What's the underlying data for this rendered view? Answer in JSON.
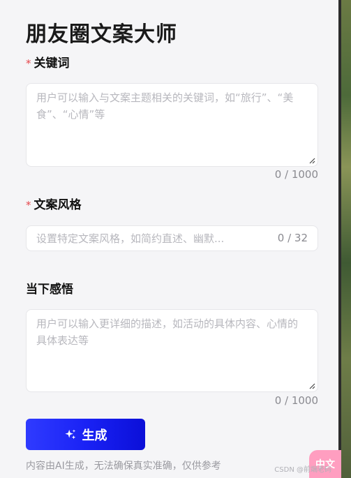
{
  "app": {
    "title": "朋友圈文案大师"
  },
  "keywords": {
    "required_mark": "*",
    "label": "关键词",
    "placeholder": "用户可以输入与文案主题相关的关键词，如“旅行”、“美食”、“心情”等",
    "value": "",
    "counter": "0 / 1000"
  },
  "style": {
    "required_mark": "*",
    "label": "文案风格",
    "placeholder": "设置特定文案风格，如简约直述、幽默...",
    "value": "",
    "counter": "0 / 32"
  },
  "feeling": {
    "label": "当下感悟",
    "placeholder": "用户可以输入更详细的描述，如活动的具体内容、心情的具体表达等",
    "value": "",
    "counter": "0 / 1000"
  },
  "actions": {
    "generate_label": "生成",
    "generate_icon": "sparkle-icon"
  },
  "footer": {
    "disclaimer": "内容由AI生成，无法确保真实准确，仅供参考",
    "watermark": "CSDN @前端老码",
    "ime_badge": "中文"
  },
  "colors": {
    "accent": "#1a22f5",
    "required": "#e5484d",
    "placeholder": "#b7b7bd",
    "background": "#f5f5f7"
  }
}
